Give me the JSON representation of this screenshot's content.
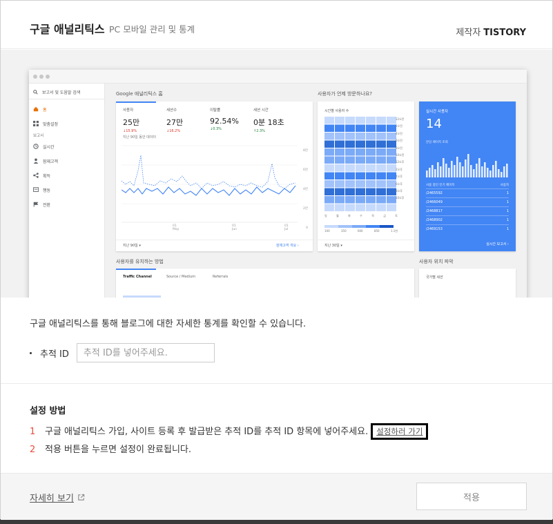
{
  "header": {
    "title": "구글 애널리틱스",
    "subtitle": "PC 모바일 관리 및 통계",
    "maker_label": "제작자",
    "maker_name": "TISTORY"
  },
  "preview": {
    "search_placeholder": "보고서 및 도움말 검색",
    "sidebar": [
      {
        "label": "홈",
        "icon": "home-icon"
      },
      {
        "label": "맞춤설정",
        "icon": "grid-icon"
      },
      {
        "label": "보고서",
        "icon": ""
      },
      {
        "label": "실시간",
        "icon": "clock-icon"
      },
      {
        "label": "잠재고객",
        "icon": "person-icon"
      },
      {
        "label": "획득",
        "icon": "share-icon"
      },
      {
        "label": "행동",
        "icon": "screen-icon"
      },
      {
        "label": "전환",
        "icon": "flag-icon"
      }
    ],
    "home_title": "Google 애널리틱스 홈",
    "visitor_question": "사용자가 언제 방문하나요?",
    "stats": [
      {
        "label": "사용자",
        "value": "25만",
        "delta": "↓15.9%"
      },
      {
        "label": "세션수",
        "value": "27만",
        "delta": "↓16.2%"
      },
      {
        "label": "이탈률",
        "value": "92.54%",
        "delta": "↓0.3%"
      },
      {
        "label": "세션 시간",
        "value": "0분 18초",
        "delta": "↑2.3%"
      }
    ],
    "stats_note": "지난 90일 동안 데이터",
    "y_ticks": [
      "8만",
      "6만",
      "4만",
      "2만",
      "0"
    ],
    "x_ticks": [
      "01 May",
      "01 Jun",
      "01 Jul"
    ],
    "period_label": "지난 90일 ▾",
    "audience_link": "잠재고객 개요",
    "heat_title": "시간별 사용자 수",
    "heat_rows": [
      "12오전",
      "2오전",
      "4오전",
      "6오전",
      "8오전",
      "10오전",
      "12오후",
      "2오후",
      "4오후",
      "6오후",
      "8오후",
      "10오후"
    ],
    "heat_days": [
      "일",
      "월",
      "화",
      "수",
      "목",
      "금",
      "토"
    ],
    "heat_legend": [
      "100",
      "350",
      "600",
      "850",
      "1.1천"
    ],
    "heat_period": "지난 30일 ▾",
    "realtime_label": "실시간 사용자",
    "realtime_value": "14",
    "realtime_sub": "분당 페이지 조회",
    "realtime_table_header": [
      "사용 중인 인기 페이지",
      "사용자"
    ],
    "realtime_pages": [
      {
        "page": "/2465592",
        "users": "1"
      },
      {
        "page": "/2466049",
        "users": "1"
      },
      {
        "page": "/2468817",
        "users": "1"
      },
      {
        "page": "/2468902",
        "users": "1"
      },
      {
        "page": "/2469153",
        "users": "1"
      }
    ],
    "realtime_link": "실시간 보고서",
    "acq_title": "사용자를 유치하는 방법",
    "acq_tabs": [
      "Traffic Channel",
      "Source / Medium",
      "Referrals"
    ],
    "location_title": "사용자 위치 파악",
    "location_card": "국가별 세션"
  },
  "body": {
    "description": "구글 애널리틱스를 통해 블로그에 대한 자세한 통계를 확인할 수 있습니다.",
    "id_label": "추적 ID",
    "id_placeholder": "추적 ID를 넣어주세요.",
    "id_value": ""
  },
  "setup": {
    "title": "설정 방법",
    "steps": [
      {
        "num": "1",
        "text": "구글 애널리틱스 가입, 사이트 등록 후 발급받은 추적 ID를 추적 ID 항목에 넣어주세요.",
        "link": "설정하러 가기"
      },
      {
        "num": "2",
        "text": "적용 버튼을 누르면 설정이 완료됩니다."
      }
    ]
  },
  "footer": {
    "more_link": "자세히 보기",
    "apply_button": "적용"
  },
  "colors": {
    "accent_red": "#e94c3c",
    "ga_blue": "#4285f4"
  }
}
